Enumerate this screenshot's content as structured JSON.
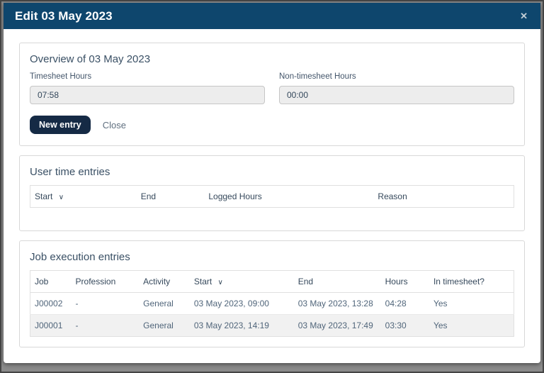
{
  "modal": {
    "title": "Edit 03 May 2023",
    "close_icon": "✕"
  },
  "icons": {
    "sort_chevron_down": "∨"
  },
  "overview": {
    "heading": "Overview of 03 May 2023",
    "fields": [
      {
        "label": "Timesheet Hours",
        "value": "07:58"
      },
      {
        "label": "Non-timesheet Hours",
        "value": "00:00"
      }
    ],
    "buttons": {
      "new_entry": "New entry",
      "close": "Close"
    }
  },
  "user_time_entries": {
    "heading": "User time entries",
    "columns": [
      "Start",
      "End",
      "Logged Hours",
      "Reason"
    ],
    "sorted_column": "Start",
    "rows": []
  },
  "job_execution_entries": {
    "heading": "Job execution entries",
    "columns": [
      "Job",
      "Profession",
      "Activity",
      "Start",
      "End",
      "Hours",
      "In timesheet?"
    ],
    "sorted_column": "Start",
    "rows": [
      [
        "J00002",
        "-",
        "General",
        "03 May 2023, 09:00",
        "03 May 2023, 13:28",
        "04:28",
        "Yes"
      ],
      [
        "J00001",
        "-",
        "General",
        "03 May 2023, 14:19",
        "03 May 2023, 17:49",
        "03:30",
        "Yes"
      ]
    ]
  },
  "colors": {
    "header_navy": "#0e466d",
    "button_navy": "#152a45",
    "heading_text": "#3a5065",
    "cell_text": "#50657a",
    "input_bg": "#ededed",
    "stripe_bg": "#f1f1f1",
    "border": "#d8d8d8"
  }
}
